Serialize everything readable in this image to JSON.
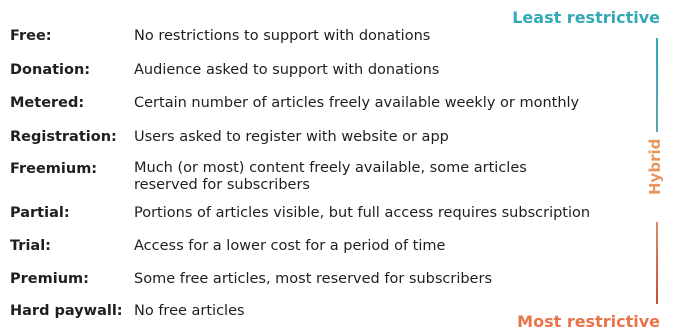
{
  "colors": {
    "least_restrictive": "#33a9b8",
    "hybrid": "#e8965a",
    "most_restrictive": "#e8744a",
    "line_top": "#33a9b8",
    "line_bottom": "#c6503a",
    "text": "#1f1f1f"
  },
  "scale": {
    "least_label": "Least restrictive",
    "hybrid_label": "Hybrid",
    "most_label": "Most restrictive"
  },
  "models": [
    {
      "term": "Free:",
      "description": "No restrictions to support with donations"
    },
    {
      "term": "Donation:",
      "description": "Audience asked to support with donations"
    },
    {
      "term": "Metered:",
      "description": "Certain number of articles freely available weekly or monthly"
    },
    {
      "term": "Registration:",
      "description": "Users asked to register with website or app"
    },
    {
      "term": "Freemium:",
      "description": "Much (or most) content freely available, some articles reserved for subscribers"
    },
    {
      "term": "Partial:",
      "description": "Portions of articles visible, but full access requires subscription"
    },
    {
      "term": "Trial:",
      "description": "Access for a lower cost for a period of time"
    },
    {
      "term": "Premium:",
      "description": "Some free articles, most reserved for subscribers"
    },
    {
      "term": "Hard paywall:",
      "description": "No free articles"
    }
  ]
}
